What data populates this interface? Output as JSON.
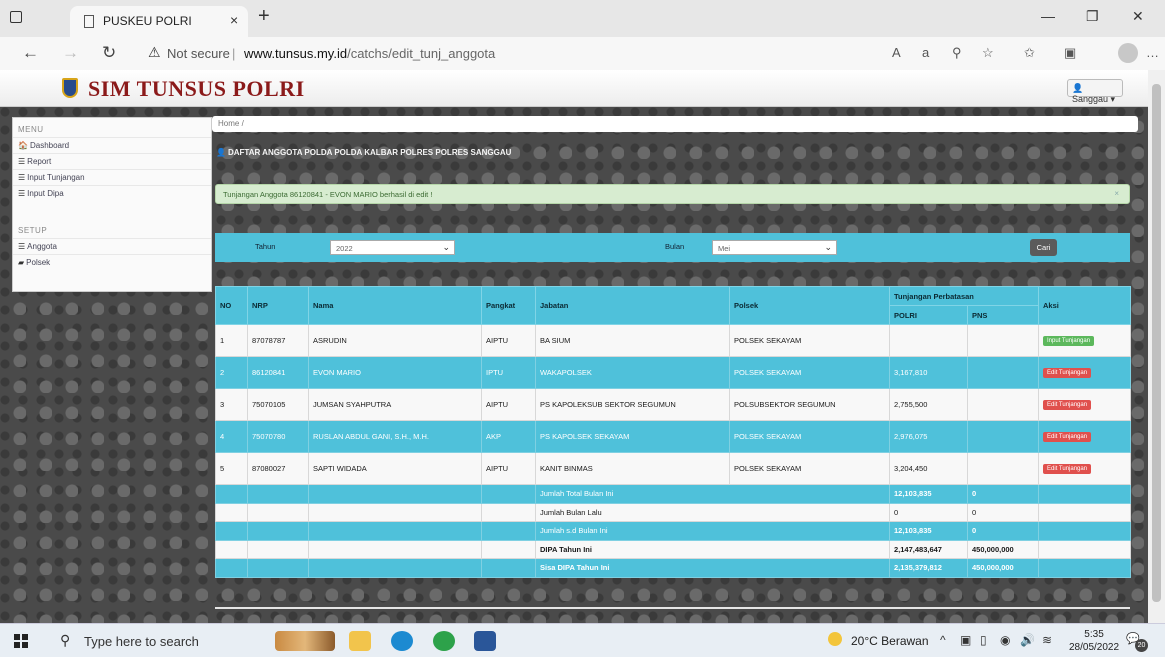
{
  "browser": {
    "tab_title": "PUSKEU POLRI",
    "tab_close": "×",
    "new_tab": "+",
    "not_secure": "Not secure",
    "url_host": "www.tunsus.my.id",
    "url_path": "/catchs/edit_tunj_anggota"
  },
  "site": {
    "brand": "SIM TUNSUS POLRI",
    "user_menu": "Sanggau ▾"
  },
  "sidebar": {
    "menu_heading": "MENU",
    "menu_items": [
      "Dashboard",
      "Report",
      "Input Tunjangan",
      "Input Dipa"
    ],
    "setup_heading": "SETUP",
    "setup_items": [
      "Anggota",
      "Polsek"
    ]
  },
  "breadcrumb": "Home /",
  "panel_title": "DAFTAR ANGGOTA POLDA POLDA KALBAR POLRES POLRES SANGGAU",
  "alert": {
    "message": "Tunjangan Anggota 86120841 - EVON MARIO berhasil di edit !",
    "close": "×"
  },
  "filter": {
    "tahun_label": "Tahun",
    "tahun_value": "2022",
    "bulan_label": "Bulan",
    "bulan_value": "Mei",
    "button": "Cari"
  },
  "table": {
    "headers": {
      "no": "NO",
      "nrp": "NRP",
      "nama": "Nama",
      "pangkat": "Pangkat",
      "jabatan": "Jabatan",
      "polsek": "Polsek",
      "tunjangan_group": "Tunjangan Perbatasan",
      "polri": "POLRI",
      "pns": "PNS",
      "aksi": "Aksi"
    },
    "rows": [
      {
        "no": "1",
        "nrp": "87078787",
        "nama": "ASRUDIN",
        "pangkat": "AIPTU",
        "jabatan": "BA SIUM",
        "polsek": "POLSEK SEKAYAM",
        "polri": "",
        "pns": "",
        "action": "Input Tunjangan"
      },
      {
        "no": "2",
        "nrp": "86120841",
        "nama": "EVON MARIO",
        "pangkat": "IPTU",
        "jabatan": "WAKAPOLSEK",
        "polsek": "POLSEK SEKAYAM",
        "polri": "3,167,810",
        "pns": "",
        "action": "Edit Tunjangan"
      },
      {
        "no": "3",
        "nrp": "75070105",
        "nama": "JUMSAN SYAHPUTRA",
        "pangkat": "AIPTU",
        "jabatan": "PS KAPOLEKSUB SEKTOR SEGUMUN",
        "polsek": "POLSUBSEKTOR SEGUMUN",
        "polri": "2,755,500",
        "pns": "",
        "action": "Edit Tunjangan"
      },
      {
        "no": "4",
        "nrp": "75070780",
        "nama": "RUSLAN ABDUL GANI, S.H., M.H.",
        "pangkat": "AKP",
        "jabatan": "PS KAPOLSEK SEKAYAM",
        "polsek": "POLSEK SEKAYAM",
        "polri": "2,976,075",
        "pns": "",
        "action": "Edit Tunjangan"
      },
      {
        "no": "5",
        "nrp": "87080027",
        "nama": "SAPTI WIDADA",
        "pangkat": "AIPTU",
        "jabatan": "KANIT BINMAS",
        "polsek": "POLSEK SEKAYAM",
        "polri": "3,204,450",
        "pns": "",
        "action": "Edit Tunjangan"
      }
    ],
    "summary": [
      {
        "label": "Jumlah Total Bulan Ini",
        "polri": "12,103,835",
        "pns": "0"
      },
      {
        "label": "Jumlah Bulan Lalu",
        "polri": "0",
        "pns": "0"
      },
      {
        "label": "Jumlah s.d Bulan Ini",
        "polri": "12,103,835",
        "pns": "0"
      },
      {
        "label": "DIPA Tahun Ini",
        "polri": "2,147,483,647",
        "pns": "450,000,000"
      },
      {
        "label": "Sisa DIPA Tahun Ini",
        "polri": "2,135,379,812",
        "pns": "450,000,000"
      }
    ]
  },
  "taskbar": {
    "search_placeholder": "Type here to search",
    "weather": "20°C Berawan",
    "time": "5:35",
    "date": "28/05/2022",
    "notification_count": "20"
  },
  "colors": {
    "accent": "#4fc1da",
    "brand": "#8b1a1a",
    "edit": "#e0504d",
    "input": "#5cb85c"
  }
}
